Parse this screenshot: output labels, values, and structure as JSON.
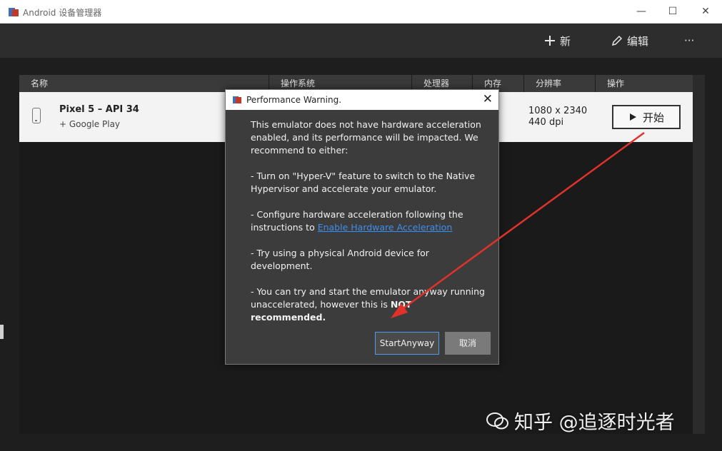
{
  "window": {
    "title": "Android 设备管理器",
    "controls": {
      "minimize": "—",
      "maximize": "☐",
      "close": "✕"
    }
  },
  "toolbar": {
    "new_label": "新",
    "edit_label": "编辑",
    "more_label": "···"
  },
  "table": {
    "headers": [
      "名称",
      "操作系统",
      "处理器",
      "内存",
      "分辨率",
      "操作"
    ],
    "rows": [
      {
        "name": "Pixel 5 – API 34",
        "subtitle": "+ Google Play",
        "resolution_line1": "1080 x 2340",
        "resolution_line2": "440 dpi",
        "action_label": "开始"
      }
    ]
  },
  "dialog": {
    "title": "Performance Warning.",
    "paragraph1": "This emulator does not have hardware acceleration enabled, and its performance will be impacted. We recommend to either:",
    "paragraph2": "- Turn on \"Hyper-V\" feature to switch to the Native Hypervisor and accelerate your emulator.",
    "paragraph3_prefix": "- Configure hardware acceleration following the instructions to ",
    "paragraph3_link": "Enable Hardware Acceleration",
    "paragraph4": "- Try using a physical Android device for development.",
    "paragraph5_prefix": "- You can try and start the emulator anyway running unaccelerated, however this is ",
    "paragraph5_bold": "NOT recommended.",
    "start_anyway_label": "StartAnyway",
    "cancel_label": "取消"
  },
  "watermark": {
    "text": "知乎 @追逐时光者"
  },
  "colors": {
    "arrow": "#e0322b",
    "link": "#3c8ef0",
    "accent_border": "#4e9ae8"
  }
}
